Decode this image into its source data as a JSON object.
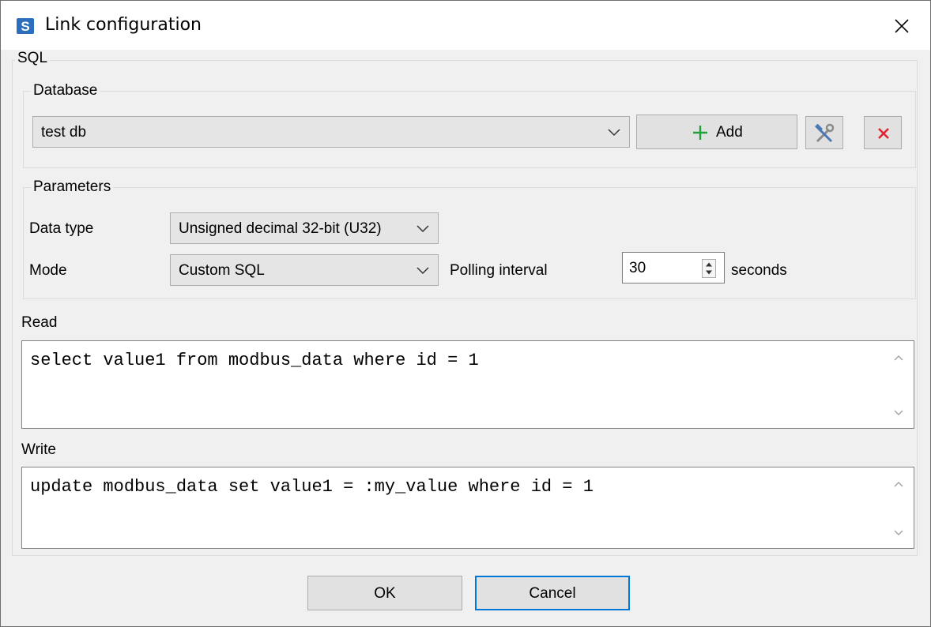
{
  "window": {
    "title": "Link configuration",
    "app_icon": "s-logo-icon",
    "close_icon": "close-icon"
  },
  "sql_group": {
    "legend": "SQL"
  },
  "database": {
    "legend": "Database",
    "selected": "test db",
    "add_label": "Add",
    "add_icon": "plus-icon",
    "edit_icon": "tools-icon",
    "delete_icon": "delete-x-icon",
    "delete_color": "#e0252f"
  },
  "parameters": {
    "legend": "Parameters",
    "data_type_label": "Data type",
    "data_type_value": "Unsigned decimal 32-bit (U32)",
    "mode_label": "Mode",
    "mode_value": "Custom SQL",
    "polling_label": "Polling interval",
    "polling_value": "30",
    "polling_unit": "seconds"
  },
  "read": {
    "label": "Read",
    "query": "select value1 from modbus_data where id = 1"
  },
  "write": {
    "label": "Write",
    "query": "update modbus_data set value1 = :my_value where id = 1"
  },
  "footer": {
    "ok_label": "OK",
    "cancel_label": "Cancel",
    "accent": "#0078d7"
  }
}
